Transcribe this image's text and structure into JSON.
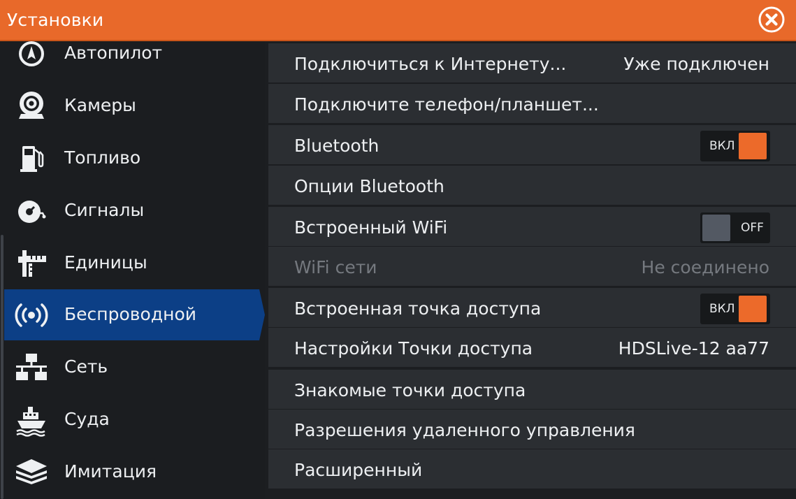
{
  "header": {
    "title": "Установки",
    "close_icon": "close-circle-icon"
  },
  "sidebar": {
    "items": [
      {
        "label": "Автопилот",
        "icon": "autopilot-icon",
        "active": false
      },
      {
        "label": "Камеры",
        "icon": "camera-icon",
        "active": false
      },
      {
        "label": "Топливо",
        "icon": "fuel-pump-icon",
        "active": false
      },
      {
        "label": "Сигналы",
        "icon": "alarm-bell-icon",
        "active": false
      },
      {
        "label": "Единицы",
        "icon": "units-ruler-icon",
        "active": false
      },
      {
        "label": "Беспроводной",
        "icon": "wireless-icon",
        "active": true
      },
      {
        "label": "Сеть",
        "icon": "network-icon",
        "active": false
      },
      {
        "label": "Суда",
        "icon": "vessels-ship-icon",
        "active": false
      },
      {
        "label": "Имитация",
        "icon": "simulation-layers-icon",
        "active": false
      }
    ]
  },
  "settings": {
    "rows": [
      {
        "label": "Подключиться к Интернету...",
        "value": "Уже подключен"
      },
      {
        "label": "Подключите телефон/планшет..."
      },
      {
        "label": "Bluetooth",
        "toggle": "ВКЛ",
        "state": "on"
      },
      {
        "label": "Опции Bluetooth"
      },
      {
        "label": "Встроенный WiFi",
        "toggle": "OFF",
        "state": "off"
      },
      {
        "label": "WiFi сети",
        "value": "Не соединено",
        "disabled": true
      },
      {
        "label": "Встроенная точка доступа",
        "toggle": "ВКЛ",
        "state": "on"
      },
      {
        "label": "Настройки Точки доступа",
        "value": "HDSLive-12 aa77"
      },
      {
        "label": "Знакомые точки доступа"
      },
      {
        "label": "Разрешения удаленного управления"
      },
      {
        "label": "Расширенный"
      }
    ]
  },
  "colors": {
    "accent": "#e8692a",
    "toggle_on": "#ec6a2a",
    "selected": "#0c3f86",
    "row_bg": "#2b2e32"
  }
}
